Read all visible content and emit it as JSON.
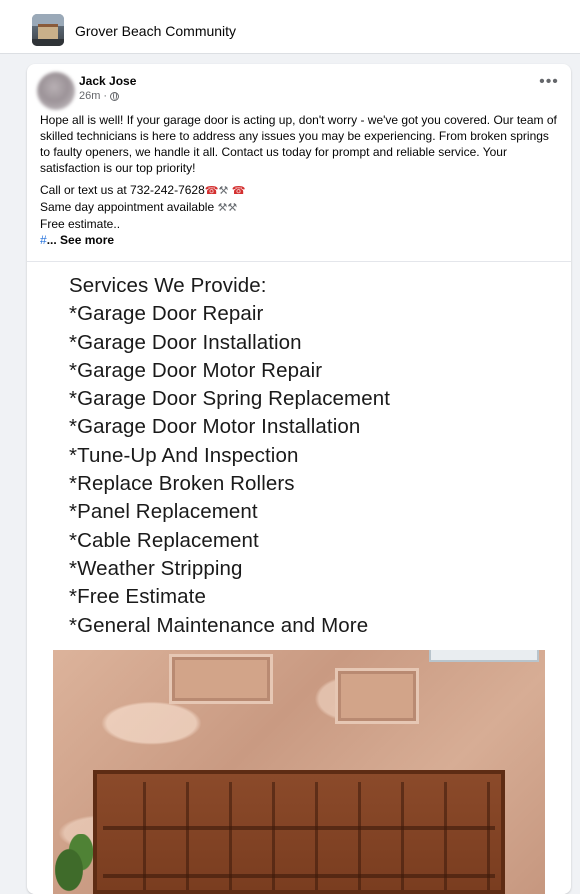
{
  "group": {
    "name": "Grover Beach Community"
  },
  "post": {
    "author": "Jack Jose",
    "time": "26m",
    "separator": "·",
    "more_label": "•••",
    "intro": "Hope all is well! If your garage door is acting up, don't worry - we've got you covered. Our team of skilled technicians is here to address any issues you may be experiencing. From broken springs to faulty openers, we handle it all. Contact us today for prompt and reliable service. Your satisfaction is our top priority!",
    "call_line": "Call or text us at 732-242-7628",
    "same_day_line": "Same day appointment available",
    "estimate_line": "Free estimate..",
    "hashtag": "#",
    "see_more": "... See more",
    "icons": {
      "phone": "☎",
      "tools": "⚒"
    }
  },
  "image": {
    "services": [
      "Services We Provide:",
      "*Garage Door Repair",
      "*Garage Door Installation",
      "*Garage Door Motor Repair",
      "*Garage Door Spring Replacement",
      "*Garage Door Motor Installation",
      "*Tune-Up And Inspection",
      "*Replace Broken Rollers",
      "*Panel Replacement",
      "*Cable Replacement",
      "*Weather Stripping",
      "*Free Estimate",
      "*General Maintenance and More"
    ]
  }
}
